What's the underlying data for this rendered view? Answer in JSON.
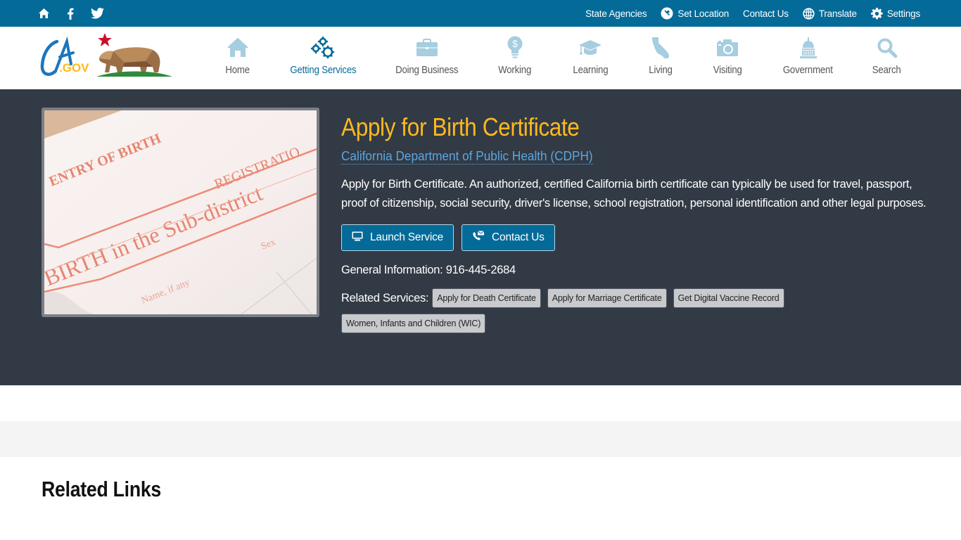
{
  "utility": {
    "left_icons": [
      "home-icon",
      "facebook-icon",
      "twitter-icon"
    ],
    "links": [
      {
        "label": "State Agencies",
        "icon": ""
      },
      {
        "label": "Set Location",
        "icon": "location-pin-icon"
      },
      {
        "label": "Contact Us",
        "icon": ""
      },
      {
        "label": "Translate",
        "icon": "globe-icon"
      },
      {
        "label": "Settings",
        "icon": "gear-icon"
      }
    ]
  },
  "header": {
    "logo_text": "CA.GOV",
    "nav": [
      {
        "label": "Home",
        "icon": "home-icon",
        "active": false
      },
      {
        "label": "Getting Services",
        "icon": "gears-icon",
        "active": true
      },
      {
        "label": "Doing Business",
        "icon": "briefcase-icon",
        "active": false
      },
      {
        "label": "Working",
        "icon": "lightbulb-dollar-icon",
        "active": false
      },
      {
        "label": "Learning",
        "icon": "graduation-cap-icon",
        "active": false
      },
      {
        "label": "Living",
        "icon": "california-icon",
        "active": false
      },
      {
        "label": "Visiting",
        "icon": "camera-icon",
        "active": false
      },
      {
        "label": "Government",
        "icon": "capitol-icon",
        "active": false
      },
      {
        "label": "Search",
        "icon": "search-icon",
        "active": false
      }
    ]
  },
  "service": {
    "title": "Apply for Birth Certificate",
    "department": "California Department of Public Health (CDPH)",
    "description": "Apply for Birth Certificate. An authorized, certified California birth certificate can typically be used for travel, passport, proof of citizenship, social security, driver's license, school registration, personal identification and other legal purposes.",
    "launch_label": "Launch Service",
    "contact_label": "Contact Us",
    "general_info": "General Information: 916-445-2684",
    "related_label": "Related Services:",
    "related": [
      "Apply for Death Certificate",
      "Apply for Marriage Certificate",
      "Get Digital Vaccine Record",
      "Women, Infants and Children (WIC)"
    ],
    "image_text": {
      "line1": "ENTRY OF BIRTH",
      "line2": "REGISTRATIO",
      "line3": "BIRTH in the Sub-district",
      "line4": "Name, if any",
      "line5": "Sex"
    }
  },
  "colors": {
    "utility_bg": "#046b99",
    "hero_bg": "#323a45",
    "title": "#fdb81e",
    "link": "#5ba6df",
    "nav_icon": "#a6cde0",
    "nav_active": "#046b99"
  },
  "related_links": {
    "heading": "Related Links"
  }
}
